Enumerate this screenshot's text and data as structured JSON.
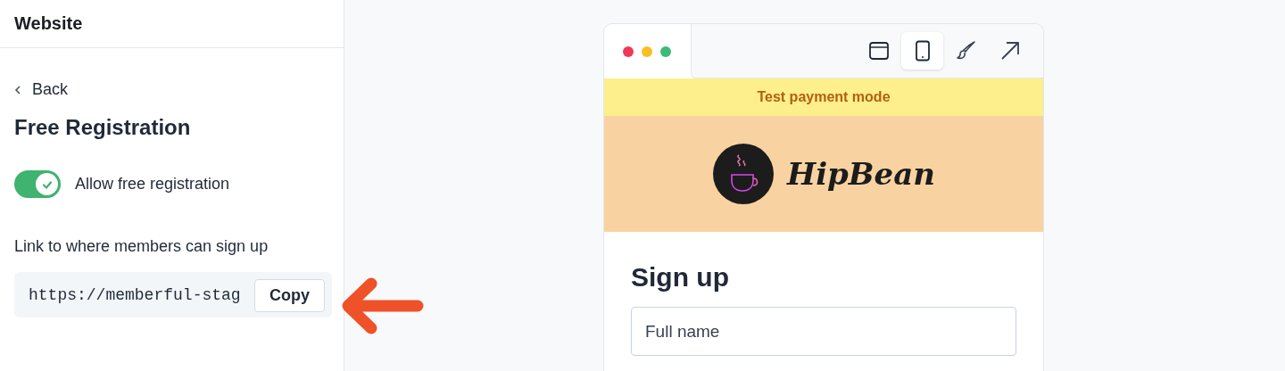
{
  "sidebar": {
    "title": "Website",
    "back": "Back",
    "heading": "Free Registration",
    "toggle": {
      "label": "Allow free registration",
      "on": true
    },
    "link": {
      "label": "Link to where members can sign up",
      "value": "https://memberful-stag",
      "button": "Copy"
    }
  },
  "preview": {
    "view_buttons": [
      {
        "kind": "desktop",
        "selected": false
      },
      {
        "kind": "mobile",
        "selected": true
      },
      {
        "kind": "brush",
        "selected": false
      },
      {
        "kind": "external",
        "selected": false
      }
    ],
    "banner": "Test payment mode",
    "brand": "HipBean",
    "form": {
      "title": "Sign up",
      "fields": [
        {
          "placeholder": "Full name"
        }
      ]
    }
  }
}
